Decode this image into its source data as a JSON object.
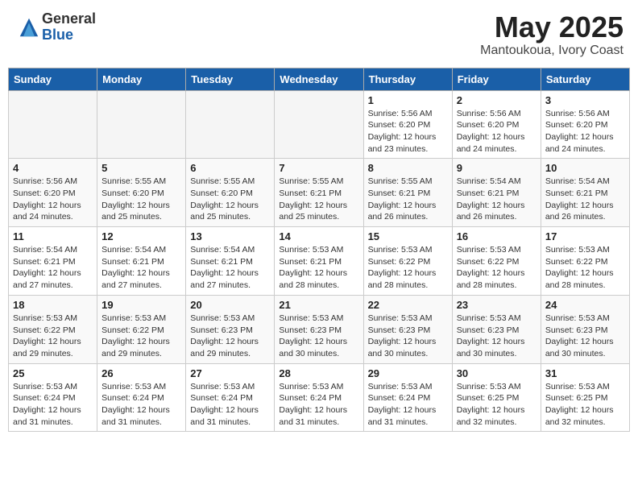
{
  "header": {
    "logo_general": "General",
    "logo_blue": "Blue",
    "month_title": "May 2025",
    "location": "Mantoukoua, Ivory Coast"
  },
  "days_of_week": [
    "Sunday",
    "Monday",
    "Tuesday",
    "Wednesday",
    "Thursday",
    "Friday",
    "Saturday"
  ],
  "weeks": [
    {
      "cells": [
        {
          "day": "",
          "info": "",
          "empty": true
        },
        {
          "day": "",
          "info": "",
          "empty": true
        },
        {
          "day": "",
          "info": "",
          "empty": true
        },
        {
          "day": "",
          "info": "",
          "empty": true
        },
        {
          "day": "1",
          "info": "Sunrise: 5:56 AM\nSunset: 6:20 PM\nDaylight: 12 hours\nand 23 minutes."
        },
        {
          "day": "2",
          "info": "Sunrise: 5:56 AM\nSunset: 6:20 PM\nDaylight: 12 hours\nand 24 minutes."
        },
        {
          "day": "3",
          "info": "Sunrise: 5:56 AM\nSunset: 6:20 PM\nDaylight: 12 hours\nand 24 minutes."
        }
      ],
      "shaded": false
    },
    {
      "cells": [
        {
          "day": "4",
          "info": "Sunrise: 5:56 AM\nSunset: 6:20 PM\nDaylight: 12 hours\nand 24 minutes."
        },
        {
          "day": "5",
          "info": "Sunrise: 5:55 AM\nSunset: 6:20 PM\nDaylight: 12 hours\nand 25 minutes."
        },
        {
          "day": "6",
          "info": "Sunrise: 5:55 AM\nSunset: 6:20 PM\nDaylight: 12 hours\nand 25 minutes."
        },
        {
          "day": "7",
          "info": "Sunrise: 5:55 AM\nSunset: 6:21 PM\nDaylight: 12 hours\nand 25 minutes."
        },
        {
          "day": "8",
          "info": "Sunrise: 5:55 AM\nSunset: 6:21 PM\nDaylight: 12 hours\nand 26 minutes."
        },
        {
          "day": "9",
          "info": "Sunrise: 5:54 AM\nSunset: 6:21 PM\nDaylight: 12 hours\nand 26 minutes."
        },
        {
          "day": "10",
          "info": "Sunrise: 5:54 AM\nSunset: 6:21 PM\nDaylight: 12 hours\nand 26 minutes."
        }
      ],
      "shaded": true
    },
    {
      "cells": [
        {
          "day": "11",
          "info": "Sunrise: 5:54 AM\nSunset: 6:21 PM\nDaylight: 12 hours\nand 27 minutes."
        },
        {
          "day": "12",
          "info": "Sunrise: 5:54 AM\nSunset: 6:21 PM\nDaylight: 12 hours\nand 27 minutes."
        },
        {
          "day": "13",
          "info": "Sunrise: 5:54 AM\nSunset: 6:21 PM\nDaylight: 12 hours\nand 27 minutes."
        },
        {
          "day": "14",
          "info": "Sunrise: 5:53 AM\nSunset: 6:21 PM\nDaylight: 12 hours\nand 28 minutes."
        },
        {
          "day": "15",
          "info": "Sunrise: 5:53 AM\nSunset: 6:22 PM\nDaylight: 12 hours\nand 28 minutes."
        },
        {
          "day": "16",
          "info": "Sunrise: 5:53 AM\nSunset: 6:22 PM\nDaylight: 12 hours\nand 28 minutes."
        },
        {
          "day": "17",
          "info": "Sunrise: 5:53 AM\nSunset: 6:22 PM\nDaylight: 12 hours\nand 28 minutes."
        }
      ],
      "shaded": false
    },
    {
      "cells": [
        {
          "day": "18",
          "info": "Sunrise: 5:53 AM\nSunset: 6:22 PM\nDaylight: 12 hours\nand 29 minutes."
        },
        {
          "day": "19",
          "info": "Sunrise: 5:53 AM\nSunset: 6:22 PM\nDaylight: 12 hours\nand 29 minutes."
        },
        {
          "day": "20",
          "info": "Sunrise: 5:53 AM\nSunset: 6:23 PM\nDaylight: 12 hours\nand 29 minutes."
        },
        {
          "day": "21",
          "info": "Sunrise: 5:53 AM\nSunset: 6:23 PM\nDaylight: 12 hours\nand 30 minutes."
        },
        {
          "day": "22",
          "info": "Sunrise: 5:53 AM\nSunset: 6:23 PM\nDaylight: 12 hours\nand 30 minutes."
        },
        {
          "day": "23",
          "info": "Sunrise: 5:53 AM\nSunset: 6:23 PM\nDaylight: 12 hours\nand 30 minutes."
        },
        {
          "day": "24",
          "info": "Sunrise: 5:53 AM\nSunset: 6:23 PM\nDaylight: 12 hours\nand 30 minutes."
        }
      ],
      "shaded": true
    },
    {
      "cells": [
        {
          "day": "25",
          "info": "Sunrise: 5:53 AM\nSunset: 6:24 PM\nDaylight: 12 hours\nand 31 minutes."
        },
        {
          "day": "26",
          "info": "Sunrise: 5:53 AM\nSunset: 6:24 PM\nDaylight: 12 hours\nand 31 minutes."
        },
        {
          "day": "27",
          "info": "Sunrise: 5:53 AM\nSunset: 6:24 PM\nDaylight: 12 hours\nand 31 minutes."
        },
        {
          "day": "28",
          "info": "Sunrise: 5:53 AM\nSunset: 6:24 PM\nDaylight: 12 hours\nand 31 minutes."
        },
        {
          "day": "29",
          "info": "Sunrise: 5:53 AM\nSunset: 6:24 PM\nDaylight: 12 hours\nand 31 minutes."
        },
        {
          "day": "30",
          "info": "Sunrise: 5:53 AM\nSunset: 6:25 PM\nDaylight: 12 hours\nand 32 minutes."
        },
        {
          "day": "31",
          "info": "Sunrise: 5:53 AM\nSunset: 6:25 PM\nDaylight: 12 hours\nand 32 minutes."
        }
      ],
      "shaded": false
    }
  ]
}
